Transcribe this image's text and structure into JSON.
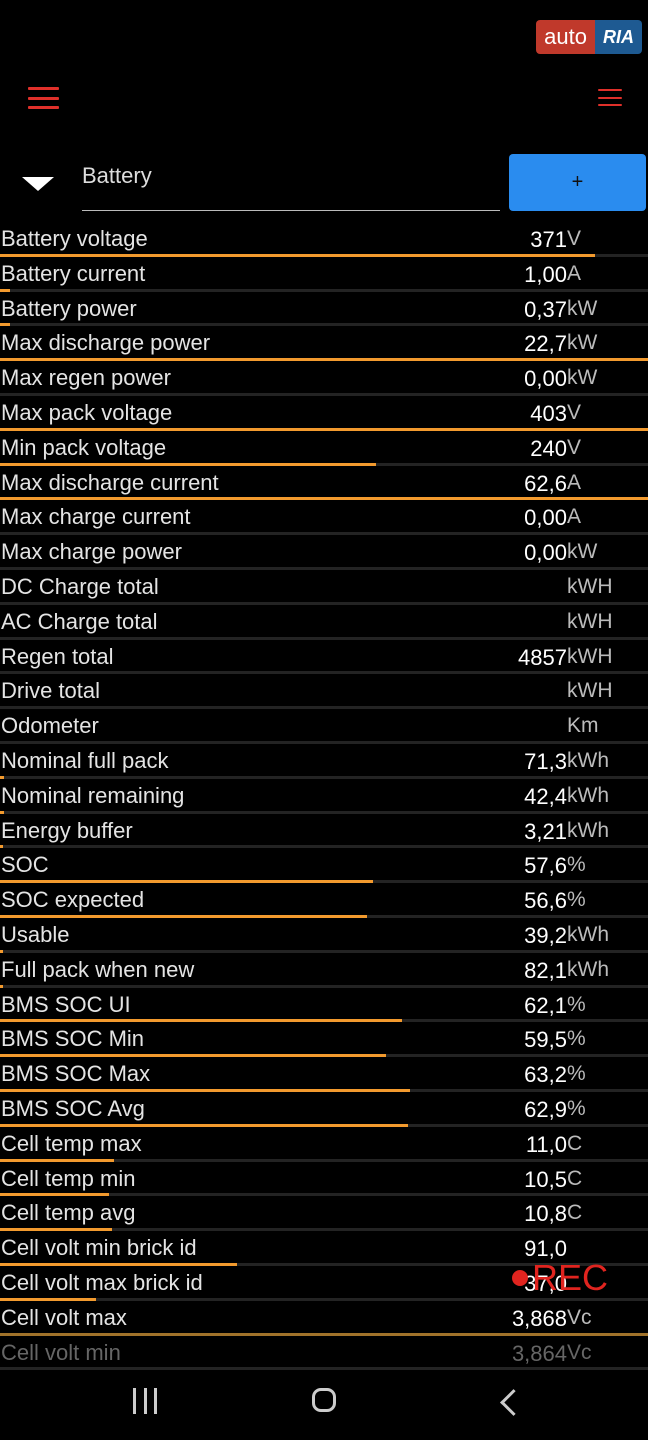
{
  "watermark": {
    "auto": "auto",
    "ria": "RIA"
  },
  "header": {
    "search_text": "Battery",
    "add_label": "+"
  },
  "rows": [
    {
      "label": "Battery voltage",
      "value": "371",
      "unit": "V",
      "bar": 0.918
    },
    {
      "label": "Battery current",
      "value": "1,00",
      "unit": "A",
      "bar": 0.016
    },
    {
      "label": "Battery power",
      "value": "0,37",
      "unit": "kW",
      "bar": 0.016
    },
    {
      "label": "Max discharge power",
      "value": "22,7",
      "unit": "kW",
      "bar": 1.0
    },
    {
      "label": "Max regen power",
      "value": "0,00",
      "unit": "kW",
      "bar": 0
    },
    {
      "label": "Max pack voltage",
      "value": "403",
      "unit": "V",
      "bar": 1.0
    },
    {
      "label": "Min pack voltage",
      "value": "240",
      "unit": "V",
      "bar": 0.58
    },
    {
      "label": "Max discharge current",
      "value": "62,6",
      "unit": "A",
      "bar": 1.0
    },
    {
      "label": "Max charge current",
      "value": "0,00",
      "unit": "A",
      "bar": 0
    },
    {
      "label": "Max charge power",
      "value": "0,00",
      "unit": "kW",
      "bar": 0
    },
    {
      "label": "DC Charge total",
      "value": "",
      "unit": "kWH",
      "bar": 0
    },
    {
      "label": "AC Charge total",
      "value": "",
      "unit": "kWH",
      "bar": 0
    },
    {
      "label": "Regen total",
      "value": "4857",
      "unit": "kWH",
      "bar": 0
    },
    {
      "label": "Drive total",
      "value": "",
      "unit": "kWH",
      "bar": 0
    },
    {
      "label": "Odometer",
      "value": "",
      "unit": "Km",
      "bar": 0
    },
    {
      "label": "Nominal full pack",
      "value": "71,3",
      "unit": "kWh",
      "bar": 0.006
    },
    {
      "label": "Nominal remaining",
      "value": "42,4",
      "unit": "kWh",
      "bar": 0.006
    },
    {
      "label": "Energy buffer",
      "value": "3,21",
      "unit": "kWh",
      "bar": 0.004
    },
    {
      "label": "SOC",
      "value": "57,6",
      "unit": "%",
      "bar": 0.576
    },
    {
      "label": "SOC expected",
      "value": "56,6",
      "unit": "%",
      "bar": 0.566
    },
    {
      "label": "Usable",
      "value": "39,2",
      "unit": "kWh",
      "bar": 0.004
    },
    {
      "label": "Full pack when new",
      "value": "82,1",
      "unit": "kWh",
      "bar": 0.004
    },
    {
      "label": "BMS SOC UI",
      "value": "62,1",
      "unit": "%",
      "bar": 0.621
    },
    {
      "label": "BMS SOC Min",
      "value": "59,5",
      "unit": "%",
      "bar": 0.595
    },
    {
      "label": "BMS SOC Max",
      "value": "63,2",
      "unit": "%",
      "bar": 0.632
    },
    {
      "label": "BMS SOC Avg",
      "value": "62,9",
      "unit": "%",
      "bar": 0.629
    },
    {
      "label": "Cell temp max",
      "value": "11,0",
      "unit": "C",
      "bar": 0.176
    },
    {
      "label": "Cell temp min",
      "value": "10,5",
      "unit": "C",
      "bar": 0.168
    },
    {
      "label": "Cell temp avg",
      "value": "10,8",
      "unit": "C",
      "bar": 0.173
    },
    {
      "label": "Cell volt min brick id",
      "value": "91,0",
      "unit": "",
      "bar": 0.366
    },
    {
      "label": "Cell volt max brick id",
      "value": "37,0",
      "unit": "",
      "bar": 0.148
    },
    {
      "label": "Cell volt max",
      "value": "3,868",
      "unit": "Vc",
      "bar": 1.0,
      "bar_color": "#a0722a"
    },
    {
      "label": "Cell volt min",
      "value": "3,864",
      "unit": "Vc",
      "bar": 0,
      "dim": true
    }
  ],
  "rec_label": "REC",
  "colors": {
    "accent": "#f29a2e",
    "menu": "#e0302a",
    "button": "#2a8cef",
    "rec": "#e0241f"
  }
}
